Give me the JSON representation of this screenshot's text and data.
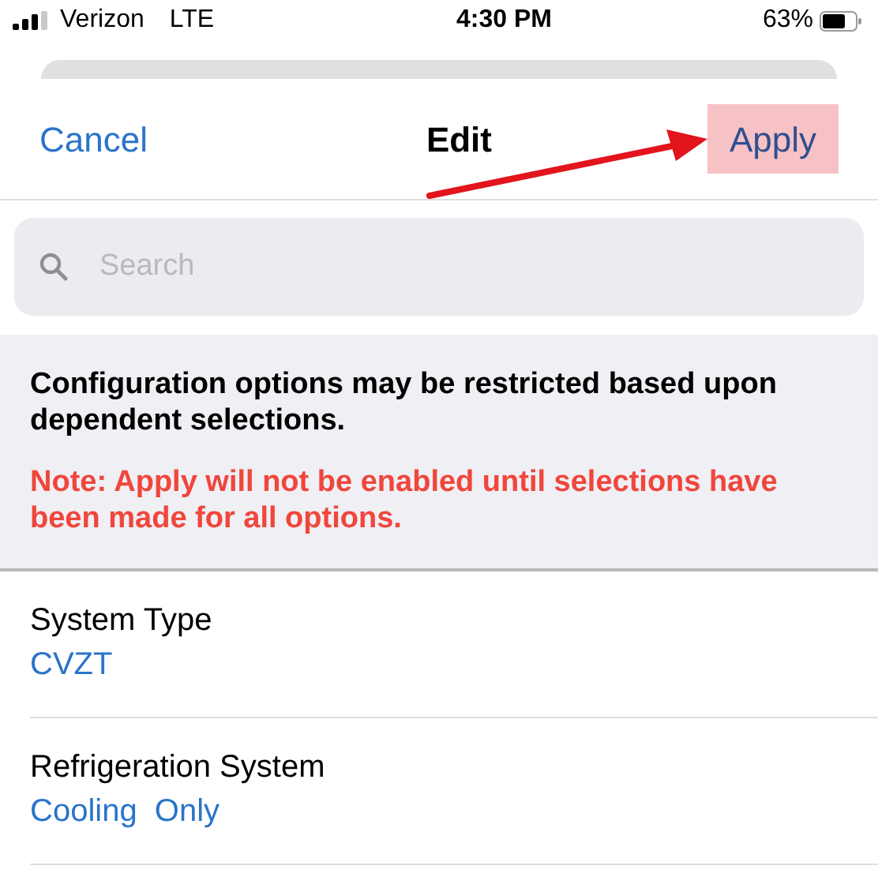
{
  "status_bar": {
    "carrier": "Verizon",
    "network": "LTE",
    "time": "4:30 PM",
    "battery": "63%"
  },
  "nav": {
    "cancel": "Cancel",
    "title": "Edit",
    "apply": "Apply",
    "apply_highlighted": true
  },
  "search": {
    "placeholder": "Search"
  },
  "info": {
    "text": "Configuration options may be restricted based upon dependent selections.",
    "note": "Note: Apply will not be enabled until selections have been made for all options."
  },
  "options": [
    {
      "label": "System Type",
      "value": "CVZT"
    },
    {
      "label": "Refrigeration System",
      "value": "Cooling  Only"
    }
  ]
}
